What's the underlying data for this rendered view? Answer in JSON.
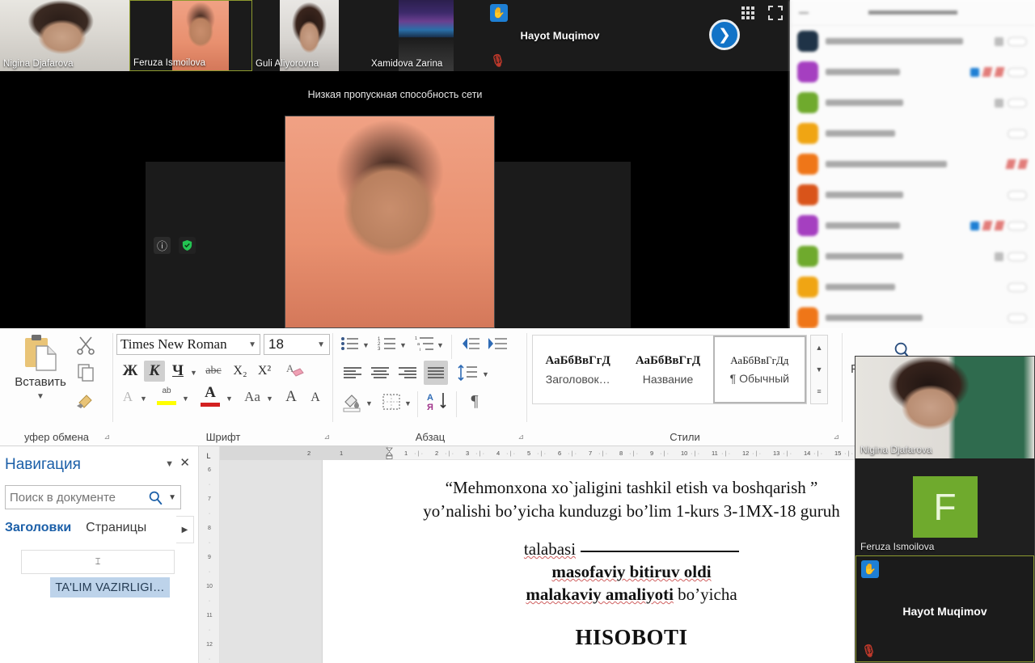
{
  "call": {
    "filmstrip": [
      {
        "name": "Nigina Djafarova",
        "active": false,
        "kind": "video"
      },
      {
        "name": "Feruza Ismoilova",
        "active": true,
        "kind": "video"
      },
      {
        "name": "Guli Aliyorovna",
        "active": false,
        "kind": "video"
      },
      {
        "name": "Xamidova Zarina",
        "active": false,
        "kind": "video"
      },
      {
        "name": "Hayot Muqimov",
        "active": false,
        "kind": "name-only"
      }
    ],
    "stage": {
      "bandwidth_message": "Низкая пропускная способность сети",
      "info_icon": "info-icon",
      "shield_icon": "shield-check-icon",
      "shield_color": "#23c552"
    },
    "controls": {
      "grid_icon": "grid-view-icon",
      "fullscreen_icon": "fullscreen-icon",
      "next_icon": "❯",
      "next_color": "#1173c7"
    },
    "hand_icon": "raised-hand-icon",
    "mute_icon": "microphone-muted-icon"
  },
  "participants_panel": {
    "blurred": true,
    "rows": [
      {
        "avatar_color": "#1f3347",
        "hand": false,
        "mute": false,
        "pill": true,
        "square": true,
        "name_width": 170
      },
      {
        "avatar_color": "#a53fc0",
        "hand": true,
        "mute": true,
        "pill": true,
        "square": false,
        "name_width": 92
      },
      {
        "avatar_color": "#6faa2d",
        "hand": false,
        "mute": false,
        "pill": true,
        "square": true,
        "name_width": 96
      },
      {
        "avatar_color": "#f0a513",
        "hand": false,
        "mute": false,
        "pill": true,
        "square": false,
        "name_width": 86
      },
      {
        "avatar_color": "#ef7618",
        "hand": false,
        "mute": true,
        "pill": false,
        "square": false,
        "name_width": 150
      },
      {
        "avatar_color": "#d9541a",
        "hand": false,
        "mute": false,
        "pill": true,
        "square": false,
        "name_width": 96
      },
      {
        "avatar_color": "#a53fc0",
        "hand": true,
        "mute": true,
        "pill": true,
        "square": false,
        "name_width": 92
      },
      {
        "avatar_color": "#6faa2d",
        "hand": false,
        "mute": false,
        "pill": true,
        "square": true,
        "name_width": 96
      },
      {
        "avatar_color": "#f0a513",
        "hand": false,
        "mute": false,
        "pill": true,
        "square": false,
        "name_width": 86
      },
      {
        "avatar_color": "#ef7618",
        "hand": false,
        "mute": false,
        "pill": true,
        "square": false,
        "name_width": 120
      }
    ]
  },
  "word": {
    "ribbon": {
      "clipboard": {
        "label": "Буфер обмена",
        "label_visible": "уфер обмена",
        "paste_label": "Вставить",
        "paste_icon": "clipboard-paste-icon",
        "cut_icon": "scissors-icon",
        "copy_icon": "copy-icon",
        "format_painter_icon": "format-painter-icon"
      },
      "font": {
        "label": "Шрифт",
        "font_name": "Times New Roman",
        "font_size": "18",
        "bold_label": "Ж",
        "italic_label": "К",
        "underline_label": "Ч",
        "strikethrough_label": "abc",
        "subscript_label": "X₂",
        "superscript_label": "X²",
        "clear_format_icon": "clear-formatting-icon",
        "text_effects_label": "A",
        "highlight_label": "ab",
        "highlight_color": "#ffff00",
        "font_color_label": "A",
        "font_color": "#d32020",
        "change_case_label": "Aa",
        "grow_font_label": "A",
        "shrink_font_label": "A",
        "italic_active": true
      },
      "paragraph": {
        "label": "Абзац",
        "bullets_icon": "bullet-list-icon",
        "numbering_icon": "numbered-list-icon",
        "multilevel_icon": "multilevel-list-icon",
        "decrease_indent_icon": "decrease-indent-icon",
        "increase_indent_icon": "increase-indent-icon",
        "align_left_icon": "align-left-icon",
        "align_center_icon": "align-center-icon",
        "align_right_icon": "align-right-icon",
        "justify_icon": "justify-icon",
        "line_spacing_icon": "line-spacing-icon",
        "shading_icon": "shading-icon",
        "borders_icon": "borders-icon",
        "sort_icon": "sort-icon",
        "sort_label": "АЯ",
        "show_marks_icon": "show-formatting-marks-icon",
        "show_marks_label": "¶",
        "justify_active": true
      },
      "styles": {
        "label": "Стили",
        "items": [
          {
            "sample": "АаБбВвГгД",
            "name": "Заголовок…",
            "selected": false
          },
          {
            "sample": "АаБбВвГгД",
            "name": "Название",
            "selected": false
          },
          {
            "sample": "АаБбВвГгДд",
            "name": "¶ Обычный",
            "selected": true
          }
        ],
        "scroll_up": "▲",
        "scroll_down": "▼",
        "more": "▤"
      },
      "editing": {
        "label_visible": "Р",
        "find_icon": "search-icon"
      }
    },
    "navigation": {
      "title": "Навигация",
      "menu_caret_icon": "chevron-down-icon",
      "close_icon": "close-icon",
      "search_placeholder": "Поиск в документе",
      "search_icon": "search-icon",
      "search_dropdown_icon": "chevron-down-icon",
      "tabs": [
        {
          "label": "Заголовки",
          "active": true
        },
        {
          "label": "Страницы",
          "active": false
        }
      ],
      "more_tabs_icon": "chevron-right-icon",
      "result_item": "⌶",
      "heading_item": "TA'LIM VAZIRLIGI…"
    },
    "rulers": {
      "tab_selector": "L",
      "horizontal_margin_marks": [
        "2",
        "1"
      ],
      "horizontal_marks": [
        "1",
        "2",
        "3",
        "4",
        "5",
        "6",
        "7",
        "8",
        "9",
        "10",
        "11",
        "12",
        "13",
        "14",
        "15"
      ],
      "vertical_marks": [
        "6",
        "7",
        "8",
        "9",
        "10",
        "11",
        "12"
      ]
    },
    "document": {
      "line1": "“Mehmonxona xo`jaligini tashkil etish va boshqarish ”",
      "line2": "yo’nalishi bo’yicha kunduzgi bo’lim 1-kurs 3-1MX-18 guruh",
      "line3_prefix": "talabasi",
      "line4": "masofaviy bitiruv oldi",
      "line5_bold": "malakaviy amaliyoti",
      "line5_rest": " bo’yicha",
      "line6": "HISOBOTI"
    }
  },
  "floating_videos": [
    {
      "name": "Nigina Djafarova",
      "kind": "video"
    },
    {
      "name": "Feruza Ismoilova",
      "kind": "avatar",
      "initial": "F",
      "avatar_color": "#6faa2d"
    },
    {
      "name": "Hayot Muqimov",
      "kind": "name-only",
      "hand": true,
      "muted": true,
      "active": true
    }
  ]
}
